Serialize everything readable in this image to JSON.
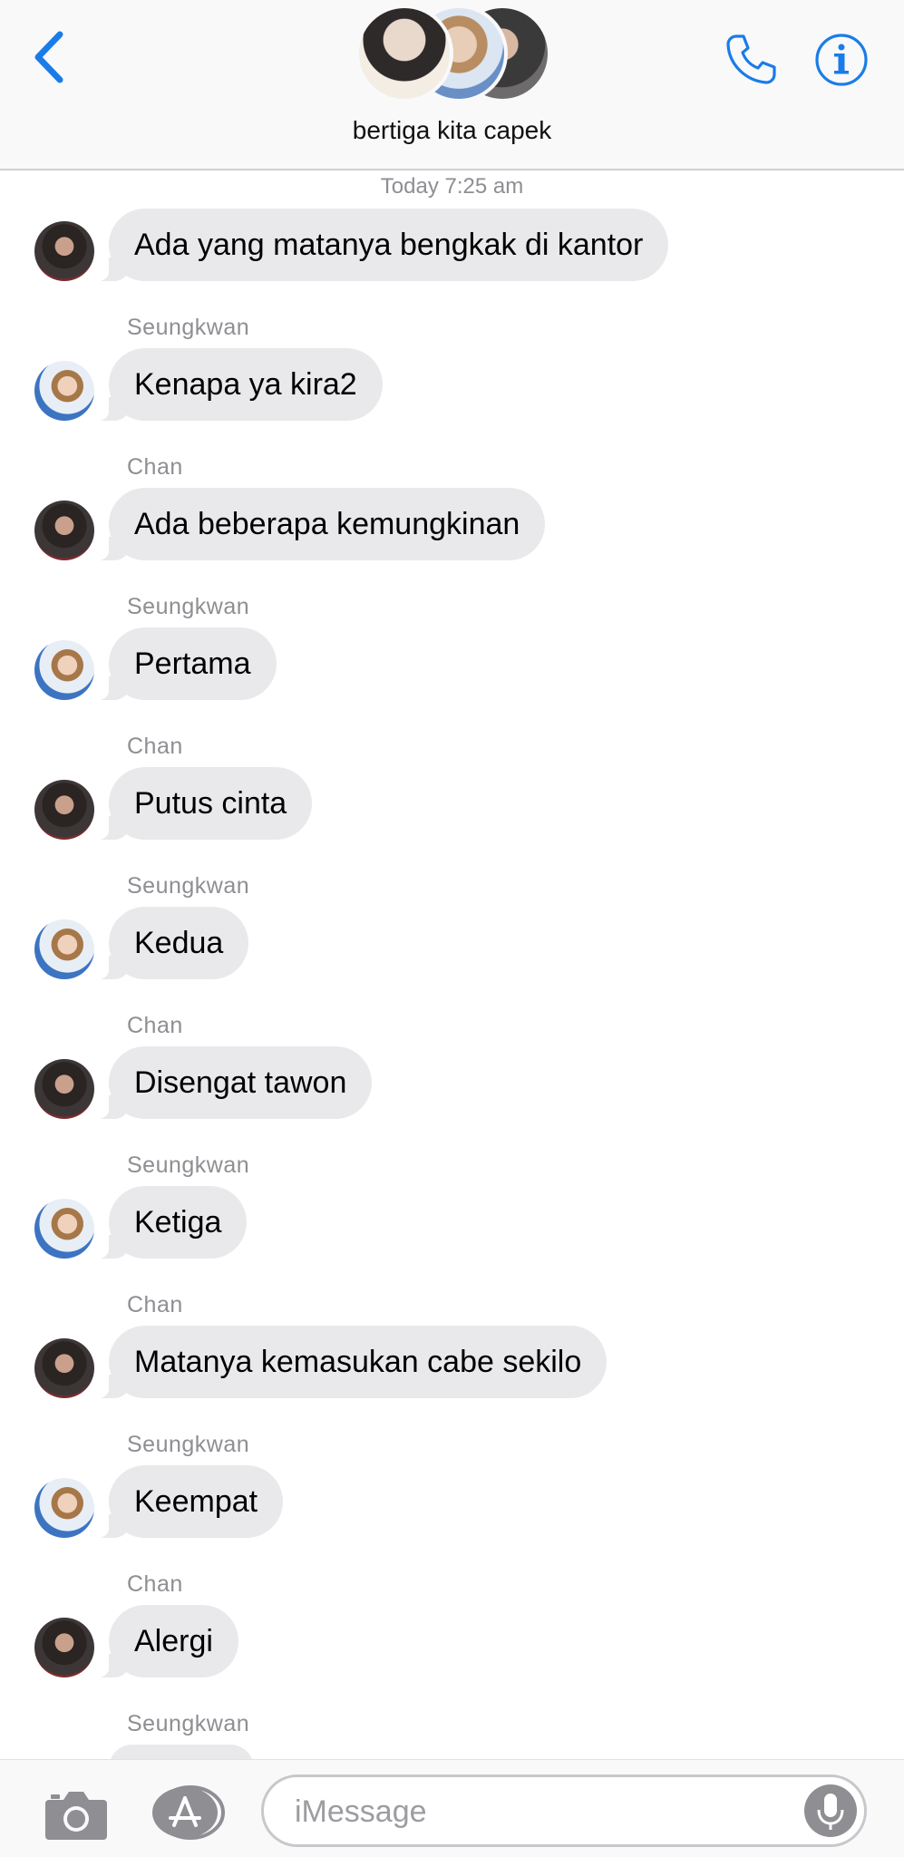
{
  "header": {
    "title": "bertiga kita capek",
    "back_icon": "chevron-left-icon",
    "call_icon": "phone-icon",
    "info_icon": "info-icon",
    "accent_color": "#1a7ce8"
  },
  "timestamp": "Today 7:25 am",
  "messages": [
    {
      "sender": "",
      "text": "Ada yang matanya bengkak di kantor",
      "avatar": "chan"
    },
    {
      "sender": "Seungkwan",
      "text": "Kenapa ya kira2",
      "avatar": "seungkwan"
    },
    {
      "sender": "Chan",
      "text": "Ada beberapa kemungkinan",
      "avatar": "chan"
    },
    {
      "sender": "Seungkwan",
      "text": "Pertama",
      "avatar": "seungkwan"
    },
    {
      "sender": "Chan",
      "text": "Putus cinta",
      "avatar": "chan"
    },
    {
      "sender": "Seungkwan",
      "text": "Kedua",
      "avatar": "seungkwan"
    },
    {
      "sender": "Chan",
      "text": "Disengat tawon",
      "avatar": "chan"
    },
    {
      "sender": "Seungkwan",
      "text": "Ketiga",
      "avatar": "seungkwan"
    },
    {
      "sender": "Chan",
      "text": "Matanya kemasukan cabe sekilo",
      "avatar": "chan"
    },
    {
      "sender": "Seungkwan",
      "text": "Keempat",
      "avatar": "seungkwan"
    },
    {
      "sender": "Chan",
      "text": "Alergi",
      "avatar": "chan"
    },
    {
      "sender": "Seungkwan",
      "text": "",
      "avatar": "seungkwan"
    }
  ],
  "composer": {
    "placeholder": "iMessage",
    "camera_icon": "camera-icon",
    "apps_icon": "app-store-icon",
    "mic_icon": "microphone-icon"
  }
}
